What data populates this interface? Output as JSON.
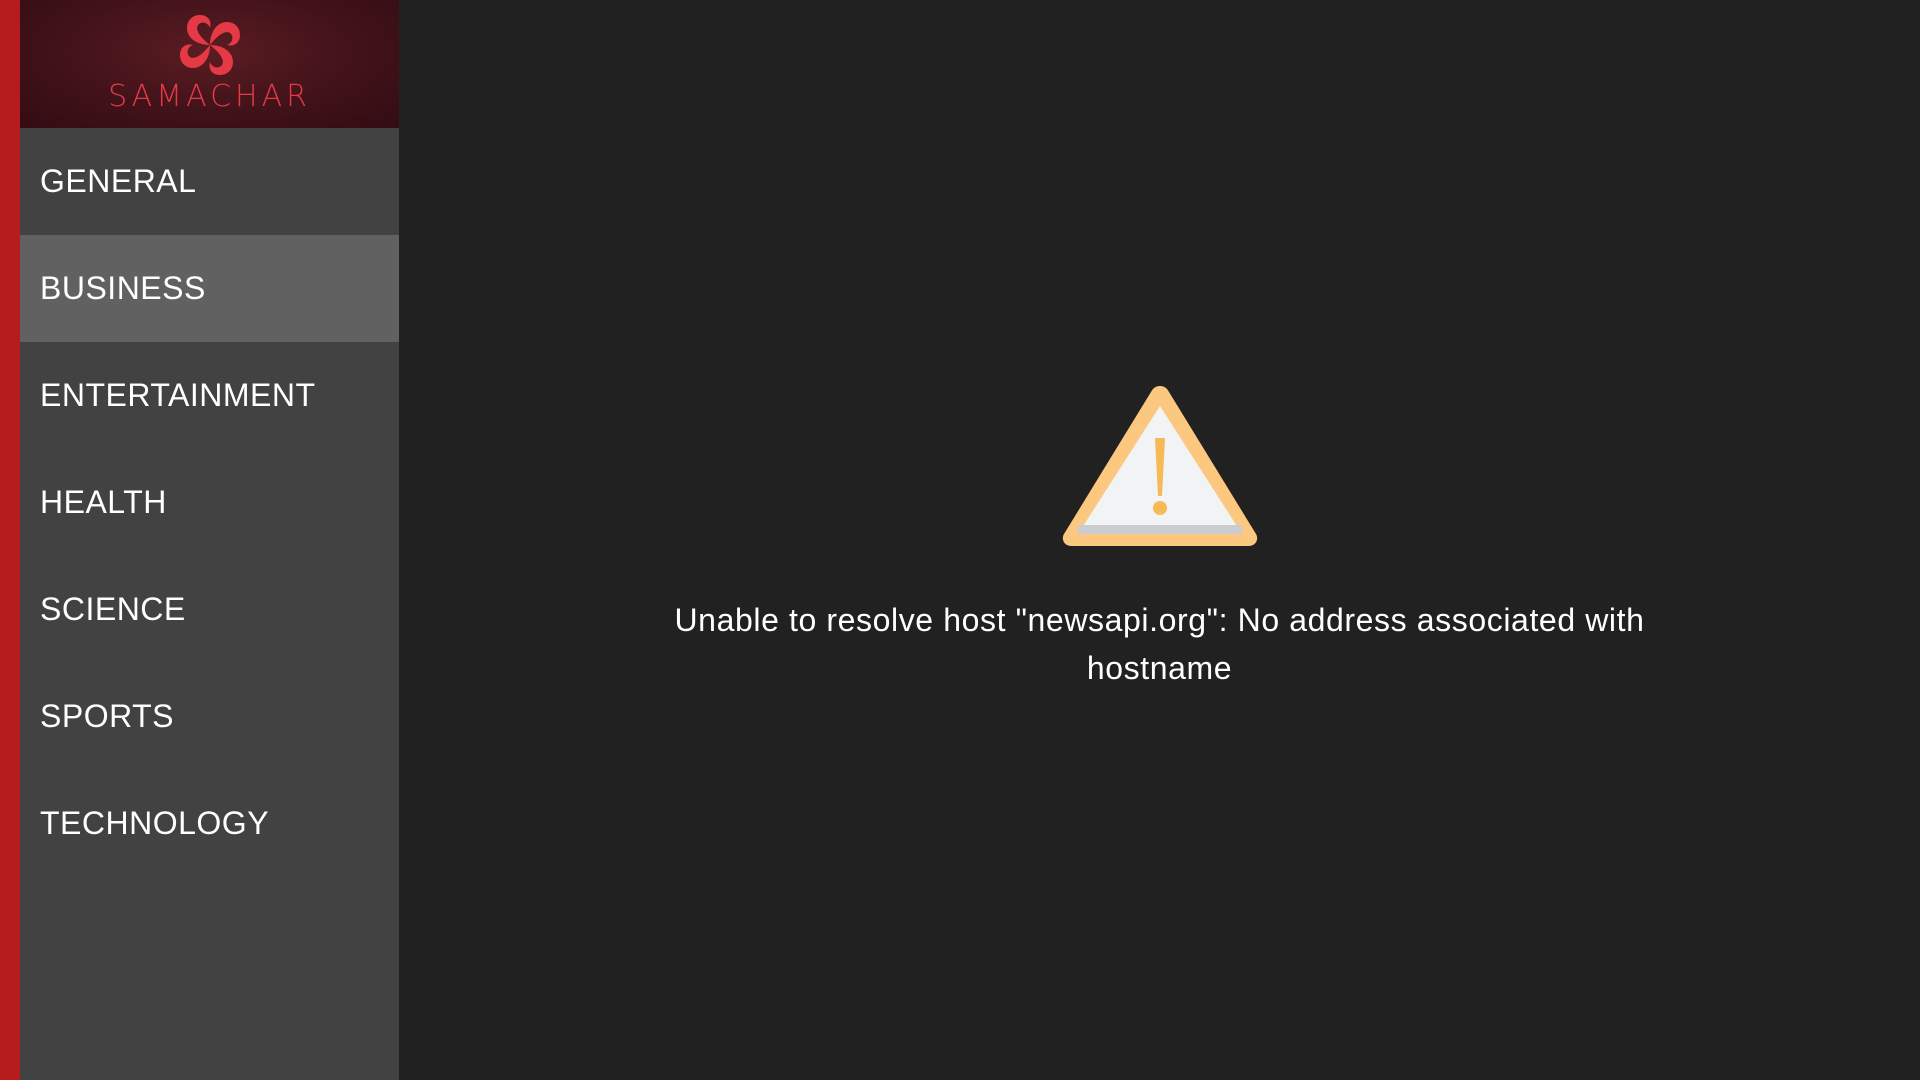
{
  "brand": {
    "name": "SAMACHAR",
    "logo_icon": "pinwheel-logo-icon"
  },
  "sidebar": {
    "items": [
      {
        "label": "GENERAL",
        "active": false
      },
      {
        "label": "BUSINESS",
        "active": true
      },
      {
        "label": "ENTERTAINMENT",
        "active": false
      },
      {
        "label": "HEALTH",
        "active": false
      },
      {
        "label": "SCIENCE",
        "active": false
      },
      {
        "label": "SPORTS",
        "active": false
      },
      {
        "label": "TECHNOLOGY",
        "active": false
      }
    ]
  },
  "error": {
    "icon": "warning-icon",
    "message": "Unable to resolve host \"newsapi.org\": No address associated with hostname"
  },
  "colors": {
    "accent_red": "#b71c1c",
    "logo_red": "#e53946",
    "sidebar_bg": "#424242",
    "sidebar_active_bg": "#616161",
    "content_bg": "#212121",
    "warning_orange": "#fcc77e"
  }
}
